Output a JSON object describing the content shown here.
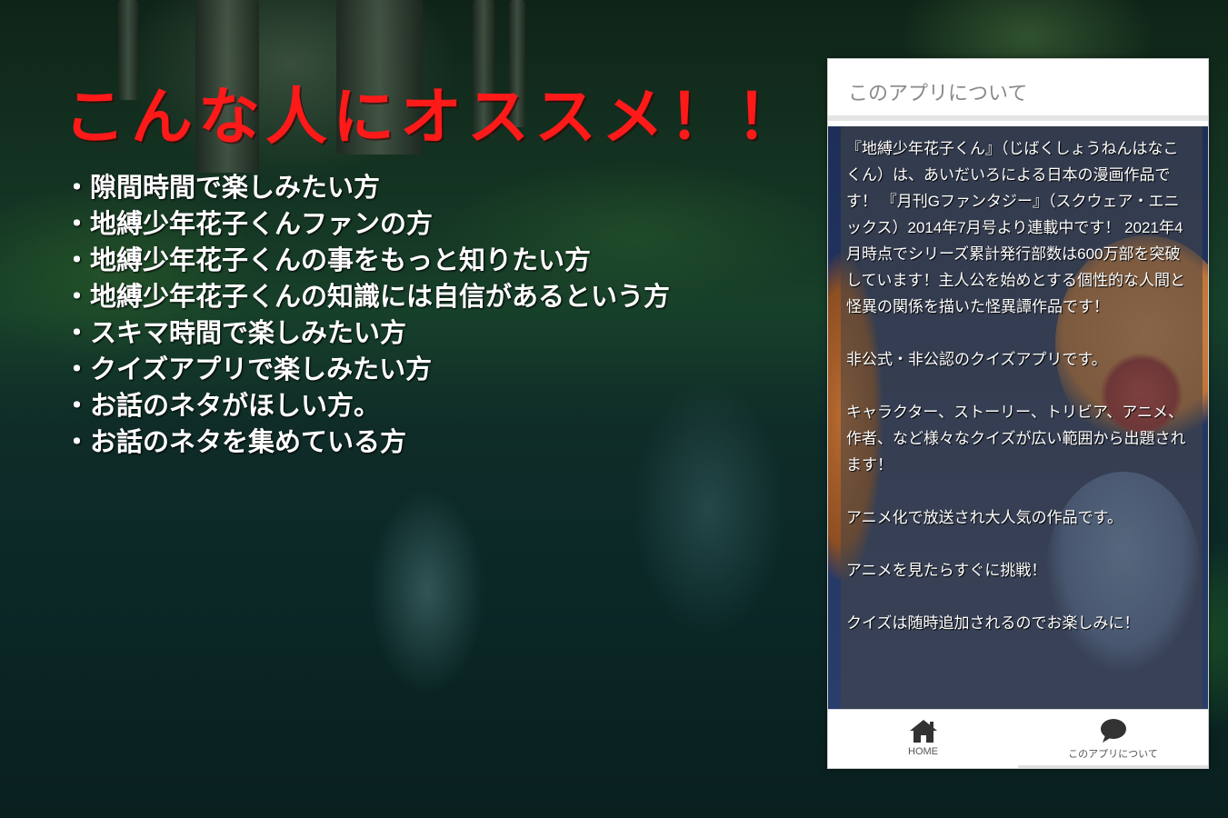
{
  "headline": "こんな人にオススメ！！",
  "bullets": [
    "隙間時間で楽しみたい方",
    "地縛少年花子くんファンの方",
    "地縛少年花子くんの事をもっと知りたい方",
    "地縛少年花子くんの知識には自信があるという方",
    "スキマ時間で楽しみたい方",
    "クイズアプリで楽しみたい方",
    "お話のネタがほしい方。",
    "お話のネタを集めている方"
  ],
  "colors": {
    "headline": "#ff1a1a",
    "bullet_text": "#ffffff"
  },
  "app": {
    "header_title": "このアプリについて",
    "about_paragraphs": [
      "『地縛少年花子くん』（じばくしょうねんはなこくん）は、あいだいろによる日本の漫画作品です！ 『月刊Gファンタジー』（スクウェア・エニックス）2014年7月号より連載中です！ 2021年4月時点でシリーズ累計発行部数は600万部を突破しています！主人公を始めとする個性的な人間と怪異の関係を描いた怪異譚作品です！",
      "非公式・非公認のクイズアプリです。",
      "キャラクター、ストーリー、トリビア、アニメ、作者、など様々なクイズが広い範囲から出題されます！",
      "アニメ化で放送され大人気の作品です。",
      "アニメを見たらすぐに挑戦！",
      "クイズは随時追加されるのでお楽しみに！"
    ],
    "tabs": [
      {
        "label": "HOME",
        "icon": "home-icon"
      },
      {
        "label": "このアプリについて",
        "icon": "chat-bubble-icon"
      }
    ]
  }
}
